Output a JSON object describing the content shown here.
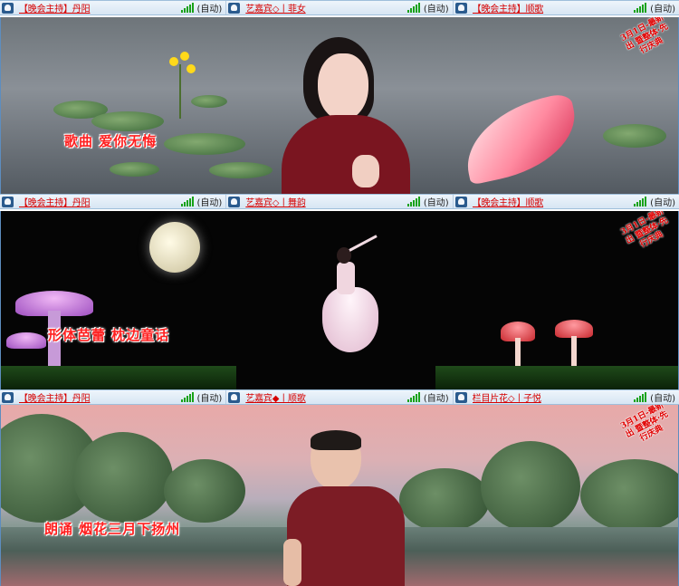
{
  "rows": [
    {
      "slots": [
        {
          "name": "【晚会主持】丹阳",
          "mode": "(自动)"
        },
        {
          "name": "艺嘉宾◇丨菲女",
          "mode": "(自动)"
        },
        {
          "name": "【晚会主持】顺歌",
          "mode": "(自动)"
        }
      ],
      "caption": "歌曲  爱你无悔",
      "badge": "3月1日-最新出 暨整体·先行庆典"
    },
    {
      "slots": [
        {
          "name": "【晚会主持】丹阳",
          "mode": "(自动)"
        },
        {
          "name": "艺嘉宾◇丨舞韵",
          "mode": "(自动)"
        },
        {
          "name": "【晚会主持】顺歌",
          "mode": "(自动)"
        }
      ],
      "caption": "形体芭蕾  枕边童话",
      "badge": "3月1日-最新出 暨整体·先行庆典"
    },
    {
      "slots": [
        {
          "name": "【晚会主持】丹阳",
          "mode": "(自动)"
        },
        {
          "name": "艺嘉宾◆丨顺歌",
          "mode": "(自动)"
        },
        {
          "name": "栏目片花◇丨子悦",
          "mode": "(自动)"
        }
      ],
      "caption": "朗诵  烟花三月下扬州",
      "badge": "3月1日-最新出 暨整体·先行庆典"
    }
  ],
  "icons": {
    "user": "mic-icon",
    "signal": "signal-icon"
  },
  "colors": {
    "name_text": "#d60000",
    "caption_text": "#ff2020",
    "strip_bg": "#d7e6f3",
    "signal": "#19a219"
  }
}
